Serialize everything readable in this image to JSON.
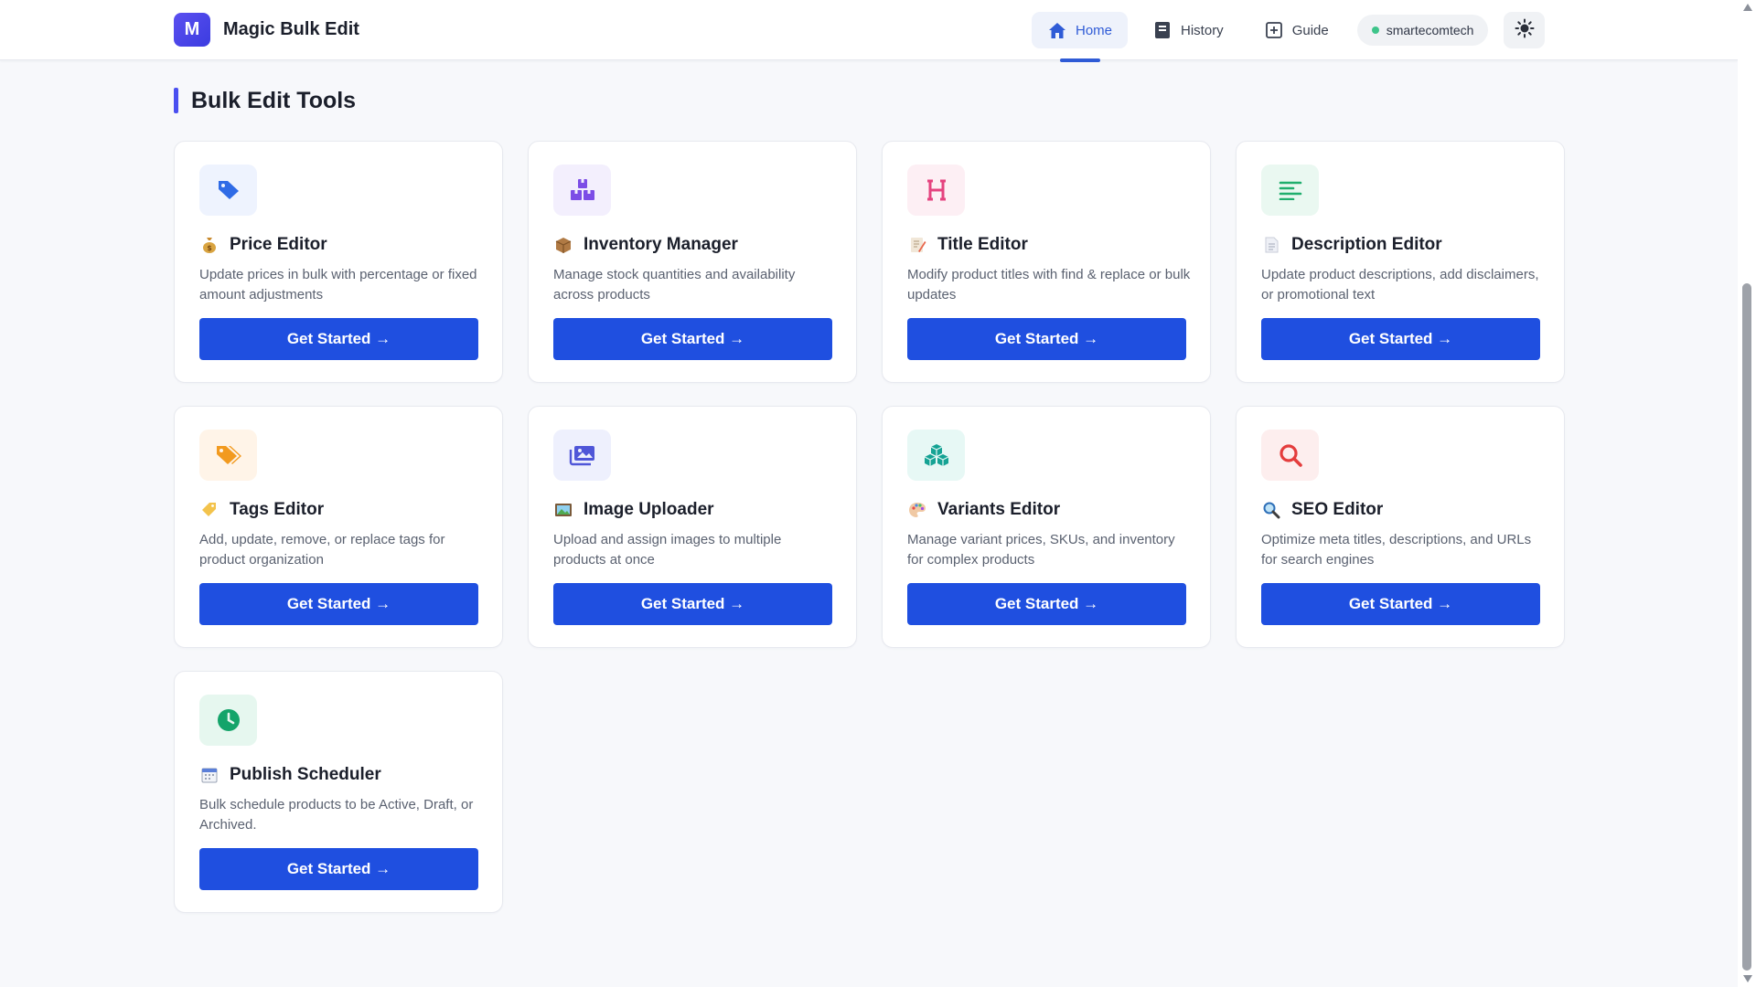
{
  "header": {
    "logo_letter": "M",
    "app_name": "Magic Bulk Edit",
    "nav": [
      {
        "label": "Home",
        "icon": "home-icon",
        "active": true
      },
      {
        "label": "History",
        "icon": "book-icon",
        "active": false
      },
      {
        "label": "Guide",
        "icon": "plus-square-icon",
        "active": false
      }
    ],
    "store": "smartecomtech",
    "theme_icon": "sun-icon"
  },
  "section": {
    "title": "Bulk Edit Tools"
  },
  "colors": {
    "primary": "#1f4fe0",
    "accent": "#4a4ff0",
    "active_nav": "#2f5bd6",
    "status_green": "#3ec48a"
  },
  "tools": [
    {
      "title": "Price Editor",
      "desc": "Update prices in bulk with percentage or fixed amount adjustments",
      "button": "Get Started →",
      "icon": "tag-icon",
      "emoji": "money-bag-icon"
    },
    {
      "title": "Inventory Manager",
      "desc": "Manage stock quantities and availability across products",
      "button": "Get Started →",
      "icon": "boxes-icon",
      "emoji": "package-icon"
    },
    {
      "title": "Title Editor",
      "desc": "Modify product titles with find & replace or bulk updates",
      "button": "Get Started →",
      "icon": "heading-icon",
      "emoji": "memo-icon"
    },
    {
      "title": "Description Editor",
      "desc": "Update product descriptions, add disclaimers, or promotional text",
      "button": "Get Started →",
      "icon": "align-left-icon",
      "emoji": "page-icon"
    },
    {
      "title": "Tags Editor",
      "desc": "Add, update, remove, or replace tags for product organization",
      "button": "Get Started →",
      "icon": "tags-icon",
      "emoji": "label-icon"
    },
    {
      "title": "Image Uploader",
      "desc": "Upload and assign images to multiple products at once",
      "button": "Get Started →",
      "icon": "images-icon",
      "emoji": "picture-icon"
    },
    {
      "title": "Variants Editor",
      "desc": "Manage variant prices, SKUs, and inventory for complex products",
      "button": "Get Started →",
      "icon": "cubes-icon",
      "emoji": "palette-icon"
    },
    {
      "title": "SEO Editor",
      "desc": "Optimize meta titles, descriptions, and URLs for search engines",
      "button": "Get Started →",
      "icon": "search-icon",
      "emoji": "magnifier-icon"
    },
    {
      "title": "Publish Scheduler",
      "desc": "Bulk schedule products to be Active, Draft, or Archived.",
      "button": "Get Started →",
      "icon": "clock-icon",
      "emoji": "calendar-icon"
    }
  ]
}
